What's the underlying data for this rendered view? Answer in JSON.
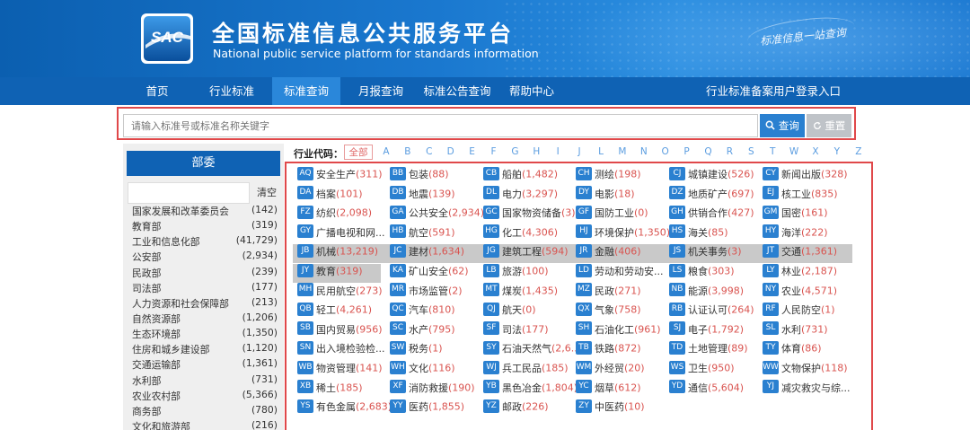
{
  "header": {
    "title": "全国标准信息公共服务平台",
    "subtitle": "National public service platform  for standards information",
    "logo_text": "SAC",
    "slogan": "标准信息一站查询"
  },
  "nav": {
    "items": [
      {
        "label": "首页"
      },
      {
        "label": "行业标准"
      },
      {
        "label": "标准查询",
        "active": true
      },
      {
        "label": "月报查询"
      },
      {
        "label": "标准公告查询"
      },
      {
        "label": "帮助中心"
      }
    ],
    "right_link": "行业标准备案用户登录入口"
  },
  "search": {
    "placeholder": "请输入标准号或标准名称关键字",
    "search_label": "查询",
    "reset_label": "重置"
  },
  "sidebar": {
    "title": "部委",
    "clear_label": "清空",
    "items": [
      {
        "name": "国家发展和改革委员会",
        "count": "(142)"
      },
      {
        "name": "教育部",
        "count": "(319)"
      },
      {
        "name": "工业和信息化部",
        "count": "(41,729)"
      },
      {
        "name": "公安部",
        "count": "(2,934)"
      },
      {
        "name": "民政部",
        "count": "(239)"
      },
      {
        "name": "司法部",
        "count": "(177)"
      },
      {
        "name": "人力资源和社会保障部",
        "count": "(213)"
      },
      {
        "name": "自然资源部",
        "count": "(1,206)"
      },
      {
        "name": "生态环境部",
        "count": "(1,350)"
      },
      {
        "name": "住房和城乡建设部",
        "count": "(1,120)"
      },
      {
        "name": "交通运输部",
        "count": "(1,361)"
      },
      {
        "name": "水利部",
        "count": "(731)"
      },
      {
        "name": "农业农村部",
        "count": "(5,366)"
      },
      {
        "name": "商务部",
        "count": "(780)"
      },
      {
        "name": "文化和旅游部",
        "count": "(216)"
      }
    ]
  },
  "industry": {
    "label": "行业代码：",
    "letters": [
      "全部",
      "A",
      "B",
      "C",
      "D",
      "E",
      "F",
      "G",
      "H",
      "I",
      "J",
      "L",
      "M",
      "N",
      "O",
      "P",
      "Q",
      "R",
      "S",
      "T",
      "W",
      "X",
      "Y",
      "Z"
    ],
    "rows": [
      [
        {
          "code": "AQ",
          "name": "安全生产",
          "count": "(311)"
        },
        {
          "code": "BB",
          "name": "包装",
          "count": "(88)"
        },
        {
          "code": "CB",
          "name": "船舶",
          "count": "(1,482)"
        },
        {
          "code": "CH",
          "name": "测绘",
          "count": "(198)"
        },
        {
          "code": "CJ",
          "name": "城镇建设",
          "count": "(526)"
        },
        {
          "code": "CY",
          "name": "新闻出版",
          "count": "(328)"
        }
      ],
      [
        {
          "code": "DA",
          "name": "档案",
          "count": "(101)"
        },
        {
          "code": "DB",
          "name": "地震",
          "count": "(139)"
        },
        {
          "code": "DL",
          "name": "电力",
          "count": "(3,297)"
        },
        {
          "code": "DY",
          "name": "电影",
          "count": "(18)"
        },
        {
          "code": "DZ",
          "name": "地质矿产",
          "count": "(697)"
        },
        {
          "code": "EJ",
          "name": "核工业",
          "count": "(835)"
        }
      ],
      [
        {
          "code": "FZ",
          "name": "纺织",
          "count": "(2,098)"
        },
        {
          "code": "GA",
          "name": "公共安全",
          "count": "(2,934)"
        },
        {
          "code": "GC",
          "name": "国家物资储备",
          "count": "(3)"
        },
        {
          "code": "GF",
          "name": "国防工业",
          "count": "(0)"
        },
        {
          "code": "GH",
          "name": "供销合作",
          "count": "(427)"
        },
        {
          "code": "GM",
          "name": "国密",
          "count": "(161)"
        }
      ],
      [
        {
          "code": "GY",
          "name": "广播电视和网...",
          "count": ""
        },
        {
          "code": "HB",
          "name": "航空",
          "count": "(591)"
        },
        {
          "code": "HG",
          "name": "化工",
          "count": "(4,306)"
        },
        {
          "code": "HJ",
          "name": "环境保护",
          "count": "(1,350)"
        },
        {
          "code": "HS",
          "name": "海关",
          "count": "(85)"
        },
        {
          "code": "HY",
          "name": "海洋",
          "count": "(222)"
        }
      ],
      [
        {
          "code": "JB",
          "name": "机械",
          "count": "(13,219)"
        },
        {
          "code": "JC",
          "name": "建材",
          "count": "(1,634)"
        },
        {
          "code": "JG",
          "name": "建筑工程",
          "count": "(594)"
        },
        {
          "code": "JR",
          "name": "金融",
          "count": "(406)"
        },
        {
          "code": "JS",
          "name": "机关事务",
          "count": "(3)"
        },
        {
          "code": "JT",
          "name": "交通",
          "count": "(1,361)"
        }
      ],
      [
        {
          "code": "JY",
          "name": "教育",
          "count": "(319)"
        },
        {
          "code": "KA",
          "name": "矿山安全",
          "count": "(62)"
        },
        {
          "code": "LB",
          "name": "旅游",
          "count": "(100)"
        },
        {
          "code": "LD",
          "name": "劳动和劳动安...",
          "count": ""
        },
        {
          "code": "LS",
          "name": "粮食",
          "count": "(303)"
        },
        {
          "code": "LY",
          "name": "林业",
          "count": "(2,187)"
        }
      ],
      [
        {
          "code": "MH",
          "name": "民用航空",
          "count": "(273)"
        },
        {
          "code": "MR",
          "name": "市场监管",
          "count": "(2)"
        },
        {
          "code": "MT",
          "name": "煤炭",
          "count": "(1,435)"
        },
        {
          "code": "MZ",
          "name": "民政",
          "count": "(271)"
        },
        {
          "code": "NB",
          "name": "能源",
          "count": "(3,998)"
        },
        {
          "code": "NY",
          "name": "农业",
          "count": "(4,571)"
        }
      ],
      [
        {
          "code": "QB",
          "name": "轻工",
          "count": "(4,261)"
        },
        {
          "code": "QC",
          "name": "汽车",
          "count": "(810)"
        },
        {
          "code": "QJ",
          "name": "航天",
          "count": "(0)"
        },
        {
          "code": "QX",
          "name": "气象",
          "count": "(758)"
        },
        {
          "code": "RB",
          "name": "认证认可",
          "count": "(264)"
        },
        {
          "code": "RF",
          "name": "人民防空",
          "count": "(1)"
        }
      ],
      [
        {
          "code": "SB",
          "name": "国内贸易",
          "count": "(956)"
        },
        {
          "code": "SC",
          "name": "水产",
          "count": "(795)"
        },
        {
          "code": "SF",
          "name": "司法",
          "count": "(177)"
        },
        {
          "code": "SH",
          "name": "石油化工",
          "count": "(961)"
        },
        {
          "code": "SJ",
          "name": "电子",
          "count": "(1,792)"
        },
        {
          "code": "SL",
          "name": "水利",
          "count": "(731)"
        }
      ],
      [
        {
          "code": "SN",
          "name": "出入境检验检...",
          "count": ""
        },
        {
          "code": "SW",
          "name": "税务",
          "count": "(1)"
        },
        {
          "code": "SY",
          "name": "石油天然气",
          "count": "(2,6..."
        },
        {
          "code": "TB",
          "name": "铁路",
          "count": "(872)"
        },
        {
          "code": "TD",
          "name": "土地管理",
          "count": "(89)"
        },
        {
          "code": "TY",
          "name": "体育",
          "count": "(86)"
        }
      ],
      [
        {
          "code": "WB",
          "name": "物资管理",
          "count": "(141)"
        },
        {
          "code": "WH",
          "name": "文化",
          "count": "(116)"
        },
        {
          "code": "WJ",
          "name": "兵工民品",
          "count": "(185)"
        },
        {
          "code": "WM",
          "name": "外经贸",
          "count": "(20)"
        },
        {
          "code": "WS",
          "name": "卫生",
          "count": "(950)"
        },
        {
          "code": "WW",
          "name": "文物保护",
          "count": "(118)"
        }
      ],
      [
        {
          "code": "XB",
          "name": "稀土",
          "count": "(185)"
        },
        {
          "code": "XF",
          "name": "消防救援",
          "count": "(190)"
        },
        {
          "code": "YB",
          "name": "黑色冶金",
          "count": "(1,804)"
        },
        {
          "code": "YC",
          "name": "烟草",
          "count": "(612)"
        },
        {
          "code": "YD",
          "name": "通信",
          "count": "(5,604)"
        },
        {
          "code": "YJ",
          "name": "减灾救灾与综...",
          "count": ""
        }
      ],
      [
        {
          "code": "YS",
          "name": "有色金属",
          "count": "(2,683)"
        },
        {
          "code": "YY",
          "name": "医药",
          "count": "(1,855)"
        },
        {
          "code": "YZ",
          "name": "邮政",
          "count": "(226)"
        },
        {
          "code": "ZY",
          "name": "中医药",
          "count": "(10)"
        }
      ]
    ]
  }
}
